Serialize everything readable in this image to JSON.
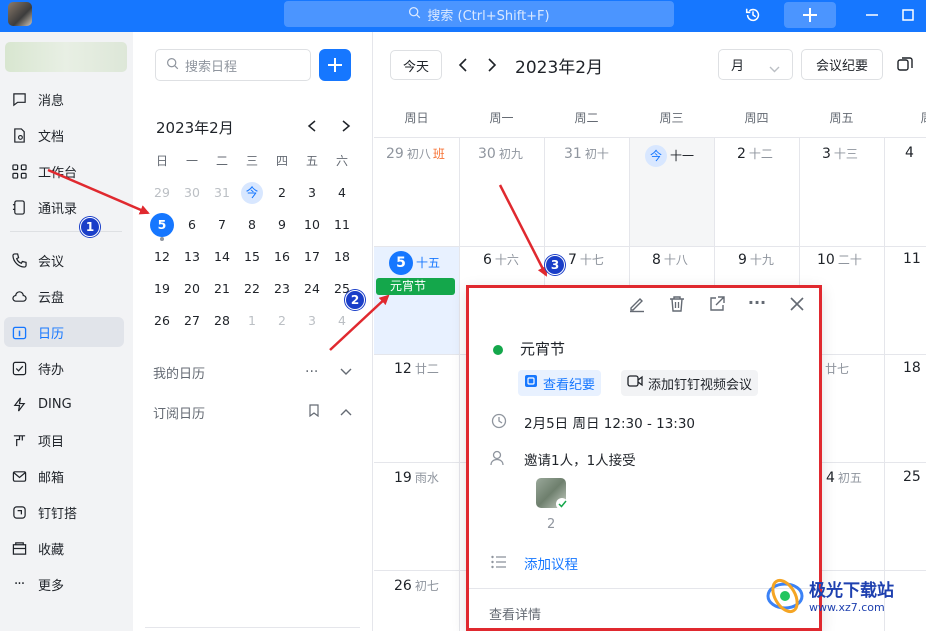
{
  "window": {
    "search_placeholder": "搜索 (Ctrl+Shift+F)"
  },
  "sidebar": {
    "items": [
      {
        "label": "消息",
        "icon": "chat-icon"
      },
      {
        "label": "文档",
        "icon": "doc-icon"
      },
      {
        "label": "工作台",
        "icon": "grid-icon"
      },
      {
        "label": "通讯录",
        "icon": "contacts-icon"
      },
      {
        "label": "会议",
        "icon": "phone-icon"
      },
      {
        "label": "云盘",
        "icon": "cloud-icon"
      },
      {
        "label": "日历",
        "icon": "calendar-icon",
        "active": true
      },
      {
        "label": "待办",
        "icon": "checkbox-icon"
      },
      {
        "label": "DING",
        "icon": "lightning-icon"
      },
      {
        "label": "项目",
        "icon": "project-icon"
      },
      {
        "label": "邮箱",
        "icon": "mail-icon"
      },
      {
        "label": "钉钉搭",
        "icon": "builder-icon"
      },
      {
        "label": "收藏",
        "icon": "bookmark-icon"
      },
      {
        "label": "更多",
        "icon": "more-icon"
      }
    ]
  },
  "mini_calendar": {
    "search_placeholder": "搜索日程",
    "month_label": "2023年2月",
    "weekdays": [
      "日",
      "一",
      "二",
      "三",
      "四",
      "五",
      "六"
    ],
    "weeks": [
      [
        "29",
        "30",
        "31",
        "今",
        "2",
        "3",
        "4"
      ],
      [
        "5",
        "6",
        "7",
        "8",
        "9",
        "10",
        "11"
      ],
      [
        "12",
        "13",
        "14",
        "15",
        "16",
        "17",
        "18"
      ],
      [
        "19",
        "20",
        "21",
        "22",
        "23",
        "24",
        "25"
      ],
      [
        "26",
        "27",
        "28",
        "1",
        "2",
        "3",
        "4"
      ]
    ],
    "my_calendars": "我的日历",
    "subscribed": "订阅日历"
  },
  "toolbar": {
    "today": "今天",
    "month_title": "2023年2月",
    "view": "月",
    "minutes": "会议纪要"
  },
  "month_view": {
    "weekdays": [
      "周日",
      "周一",
      "周二",
      "周三",
      "周四",
      "周五",
      "周"
    ],
    "row1": [
      {
        "d": "29",
        "l": "初八",
        "ban": "班"
      },
      {
        "d": "30",
        "l": "初九"
      },
      {
        "d": "31",
        "l": "初十"
      },
      {
        "d": "今",
        "l": "十一"
      },
      {
        "d": "2",
        "l": "十二"
      },
      {
        "d": "3",
        "l": "十三"
      },
      {
        "d": "4",
        "l": ""
      }
    ],
    "row2": [
      {
        "d": "5",
        "l": "十五"
      },
      {
        "d": "6",
        "l": "十六"
      },
      {
        "d": "7",
        "l": "十七"
      },
      {
        "d": "8",
        "l": "十八"
      },
      {
        "d": "9",
        "l": "十九"
      },
      {
        "d": "10",
        "l": "二十"
      },
      {
        "d": "11",
        "l": ""
      }
    ],
    "row3_sun": {
      "d": "12",
      "l": "廿二"
    },
    "row3_fri": {
      "d": "",
      "l": "廿七"
    },
    "row3_sat": {
      "d": "18",
      "l": ""
    },
    "row4_sun": {
      "d": "19",
      "l": "雨水"
    },
    "row4_fri": {
      "d": "4",
      "l": "初五"
    },
    "row4_sat": {
      "d": "25",
      "l": ""
    },
    "row5_sun": {
      "d": "26",
      "l": "初七"
    },
    "event_label": "元宵节"
  },
  "popup": {
    "title": "元宵节",
    "view_minutes": "查看纪要",
    "add_video": "添加钉钉视频会议",
    "time": "2月5日 周日 12:30 - 13:30",
    "invite": "邀请1人，1人接受",
    "attendee_count": "2",
    "add_agenda": "添加议程",
    "view_details": "查看详情"
  },
  "annotations": {
    "n1": "1",
    "n2": "2",
    "n3": "3"
  },
  "watermark": {
    "text": "极光下载站",
    "url": "www.xz7.com"
  },
  "colors": {
    "brand": "#1677ff",
    "event": "#14a74b",
    "annotation_red": "#e0292f",
    "annotation_badge": "#1a3ec8"
  }
}
